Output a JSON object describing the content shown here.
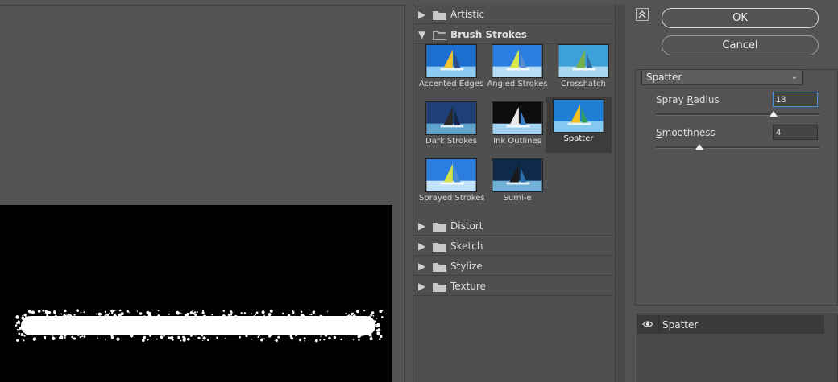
{
  "gallery": {
    "categories_top": [
      {
        "label": "Artistic",
        "expanded": false
      },
      {
        "label": "Brush Strokes",
        "expanded": true
      }
    ],
    "thumbnails": [
      {
        "label": "Accented Edges",
        "selected": false
      },
      {
        "label": "Angled Strokes",
        "selected": false
      },
      {
        "label": "Crosshatch",
        "selected": false
      },
      {
        "label": "Dark Strokes",
        "selected": false
      },
      {
        "label": "Ink Outlines",
        "selected": false
      },
      {
        "label": "Spatter",
        "selected": true
      },
      {
        "label": "Sprayed Strokes",
        "selected": false
      },
      {
        "label": "Sumi-e",
        "selected": false
      }
    ],
    "categories_bottom": [
      {
        "label": "Distort",
        "expanded": false
      },
      {
        "label": "Sketch",
        "expanded": false
      },
      {
        "label": "Stylize",
        "expanded": false
      },
      {
        "label": "Texture",
        "expanded": false
      }
    ]
  },
  "dialog": {
    "ok_label": "OK",
    "cancel_label": "Cancel",
    "collapse_icon": "collapse-up-icon"
  },
  "settings": {
    "filter_select": "Spatter",
    "spray_radius": {
      "label_pre": "Spray ",
      "label_mnemonic": "R",
      "label_post": "adius",
      "value": "18",
      "max": 25
    },
    "smoothness": {
      "label_mnemonic": "S",
      "label_post": "moothness",
      "value": "4",
      "max": 15
    }
  },
  "layers": {
    "items": [
      {
        "name": "Spatter",
        "visible": true
      }
    ]
  },
  "colors": {
    "background": "#535353",
    "canvas": "#000000",
    "accent": "#4a8fe0"
  }
}
